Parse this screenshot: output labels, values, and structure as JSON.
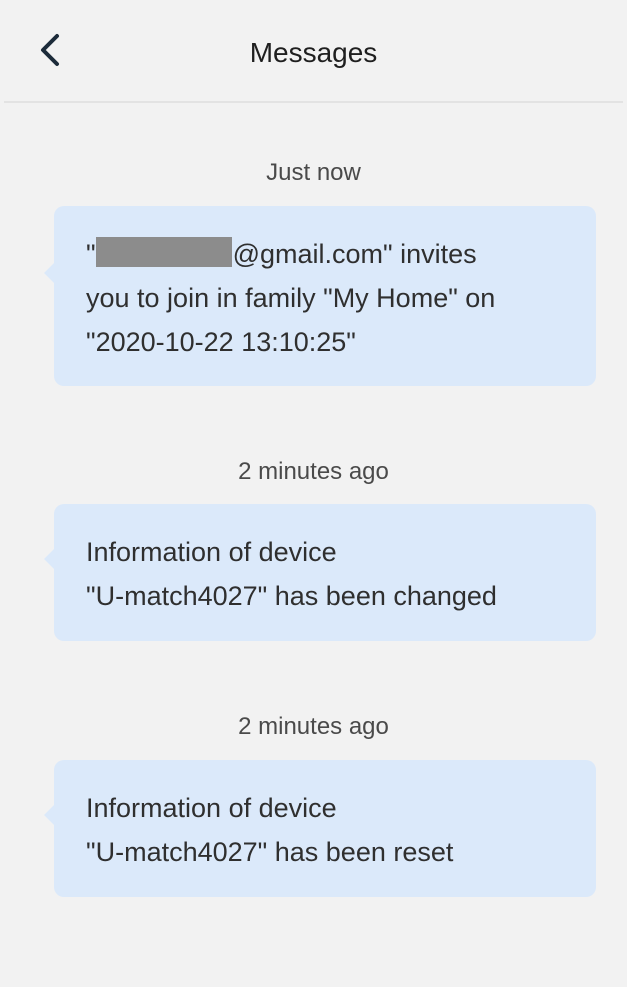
{
  "header": {
    "title": "Messages",
    "back_icon": "chevron-left-icon"
  },
  "messages": [
    {
      "timestamp": "Just now",
      "line1_prefix": "\"",
      "line1_suffix": "@gmail.com\" invites",
      "line2": "you to join in family \"My Home\" on",
      "line3": "\"2020-10-22 13:10:25\""
    },
    {
      "timestamp": "2 minutes ago",
      "line1": "Information of device",
      "line2": "\"U-match4027\" has been changed"
    },
    {
      "timestamp": "2 minutes ago",
      "line1": "Information of device",
      "line2": "\"U-match4027\" has been reset"
    }
  ],
  "colors": {
    "background": "#f2f2f2",
    "bubble": "#dbe9fa",
    "redaction": "#8c8c8c",
    "back_arrow": "#1c2b3a"
  }
}
